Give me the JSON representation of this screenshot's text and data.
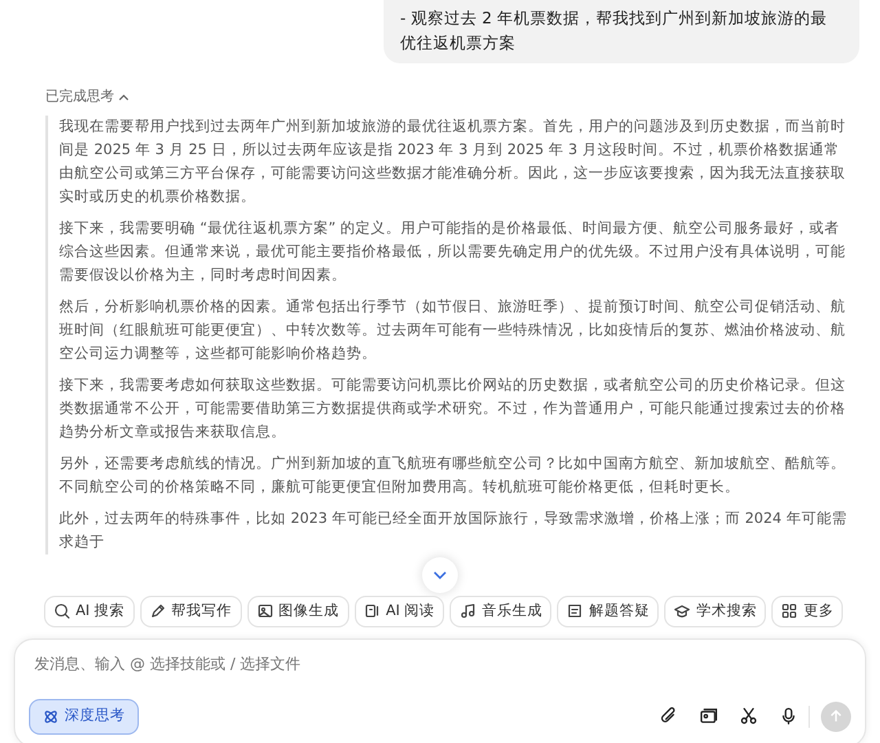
{
  "user_message": {
    "text": "- 观察过去 2 年机票数据，帮我找到广州到新加坡旅游的最优往返机票方案"
  },
  "thinking": {
    "label": "已完成思考",
    "expanded": true,
    "paragraphs": [
      "我现在需要帮用户找到过去两年广州到新加坡旅游的最优往返机票方案。首先，用户的问题涉及到历史数据，而当前时间是 2025 年 3 月 25 日，所以过去两年应该是指 2023 年 3 月到 2025 年 3 月这段时间。不过，机票价格数据通常由航空公司或第三方平台保存，可能需要访问这些数据才能准确分析。因此，这一步应该要搜索，因为我无法直接获取实时或历史的机票价格数据。",
      "接下来，我需要明确 “最优往返机票方案” 的定义。用户可能指的是价格最低、时间最方便、航空公司服务最好，或者综合这些因素。但通常来说，最优可能主要指价格最低，所以需要先确定用户的优先级。不过用户没有具体说明，可能需要假设以价格为主，同时考虑时间因素。",
      "然后，分析影响机票价格的因素。通常包括出行季节（如节假日、旅游旺季）、提前预订时间、航空公司促销活动、航班时间（红眼航班可能更便宜）、中转次数等。过去两年可能有一些特殊情况，比如疫情后的复苏、燃油价格波动、航空公司运力调整等，这些都可能影响价格趋势。",
      "接下来，我需要考虑如何获取这些数据。可能需要访问机票比价网站的历史数据，或者航空公司的历史价格记录。但这类数据通常不公开，可能需要借助第三方数据提供商或学术研究。不过，作为普通用户，可能只能通过搜索过去的价格趋势分析文章或报告来获取信息。",
      "另外，还需要考虑航线的情况。广州到新加坡的直飞航班有哪些航空公司？比如中国南方航空、新加坡航空、酷航等。不同航空公司的价格策略不同，廉航可能更便宜但附加费用高。转机航班可能价格更低，但耗时更长。",
      "此外，过去两年的特殊事件，比如 2023 年可能已经全面开放国际旅行，导致需求激增，价格上涨；而 2024 年可能需求趋于"
    ]
  },
  "tools": [
    {
      "label": "AI 搜索"
    },
    {
      "label": "帮我写作"
    },
    {
      "label": "图像生成"
    },
    {
      "label": "AI 阅读"
    },
    {
      "label": "音乐生成"
    },
    {
      "label": "解题答疑"
    },
    {
      "label": "学术搜索"
    },
    {
      "label": "更多"
    }
  ],
  "composer": {
    "placeholder": "发消息、输入 @ 选择技能或 / 选择文件",
    "deep_think": {
      "label": "深度思考",
      "selected": true
    },
    "send_disabled": true
  }
}
